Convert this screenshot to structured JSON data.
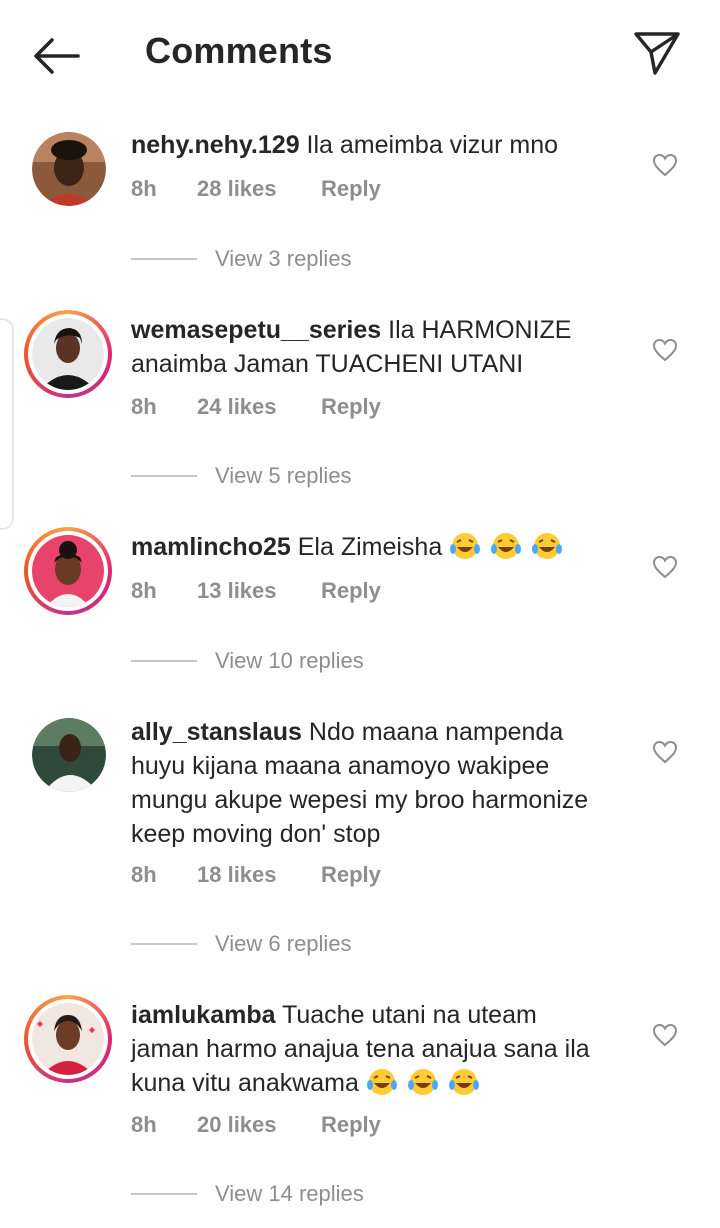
{
  "header": {
    "title": "Comments",
    "back_icon": "arrow-left-icon",
    "send_icon": "paper-plane-icon"
  },
  "comments": [
    {
      "username": "nehy.nehy.129",
      "text": "Ila ameimba vizur mno",
      "time": "8h",
      "likes": "28 likes",
      "reply": "Reply",
      "view_replies": "View 3 replies",
      "has_story_ring": false,
      "emojis": 0
    },
    {
      "username": "wemasepetu__series",
      "text": "Ila HARMONIZE anaimba Jaman TUACHENI UTANI",
      "time": "8h",
      "likes": "24 likes",
      "reply": "Reply",
      "view_replies": "View 5 replies",
      "has_story_ring": true,
      "emojis": 0
    },
    {
      "username": "mamlincho25",
      "text": "Ela Zimeisha",
      "time": "8h",
      "likes": "13 likes",
      "reply": "Reply",
      "view_replies": "View 10 replies",
      "has_story_ring": true,
      "emojis": 3
    },
    {
      "username": "ally_stanslaus",
      "text": "Ndo maana nampenda huyu kijana maana anamoyo wakipee mungu akupe wepesi my  broo harmonize keep moving don' stop",
      "time": "8h",
      "likes": "18 likes",
      "reply": "Reply",
      "view_replies": "View 6 replies",
      "has_story_ring": false,
      "emojis": 0
    },
    {
      "username": "iamlukamba",
      "text": "Tuache utani na uteam jaman harmo anajua tena anajua sana ila kuna vitu anakwama",
      "time": "8h",
      "likes": "20 likes",
      "reply": "Reply",
      "view_replies": "View 14 replies",
      "has_story_ring": true,
      "emojis": 3
    }
  ],
  "colors": {
    "text": "#262626",
    "secondary": "#8e8e8e",
    "ring_start": "#f7a54a",
    "ring_end": "#c13584"
  }
}
